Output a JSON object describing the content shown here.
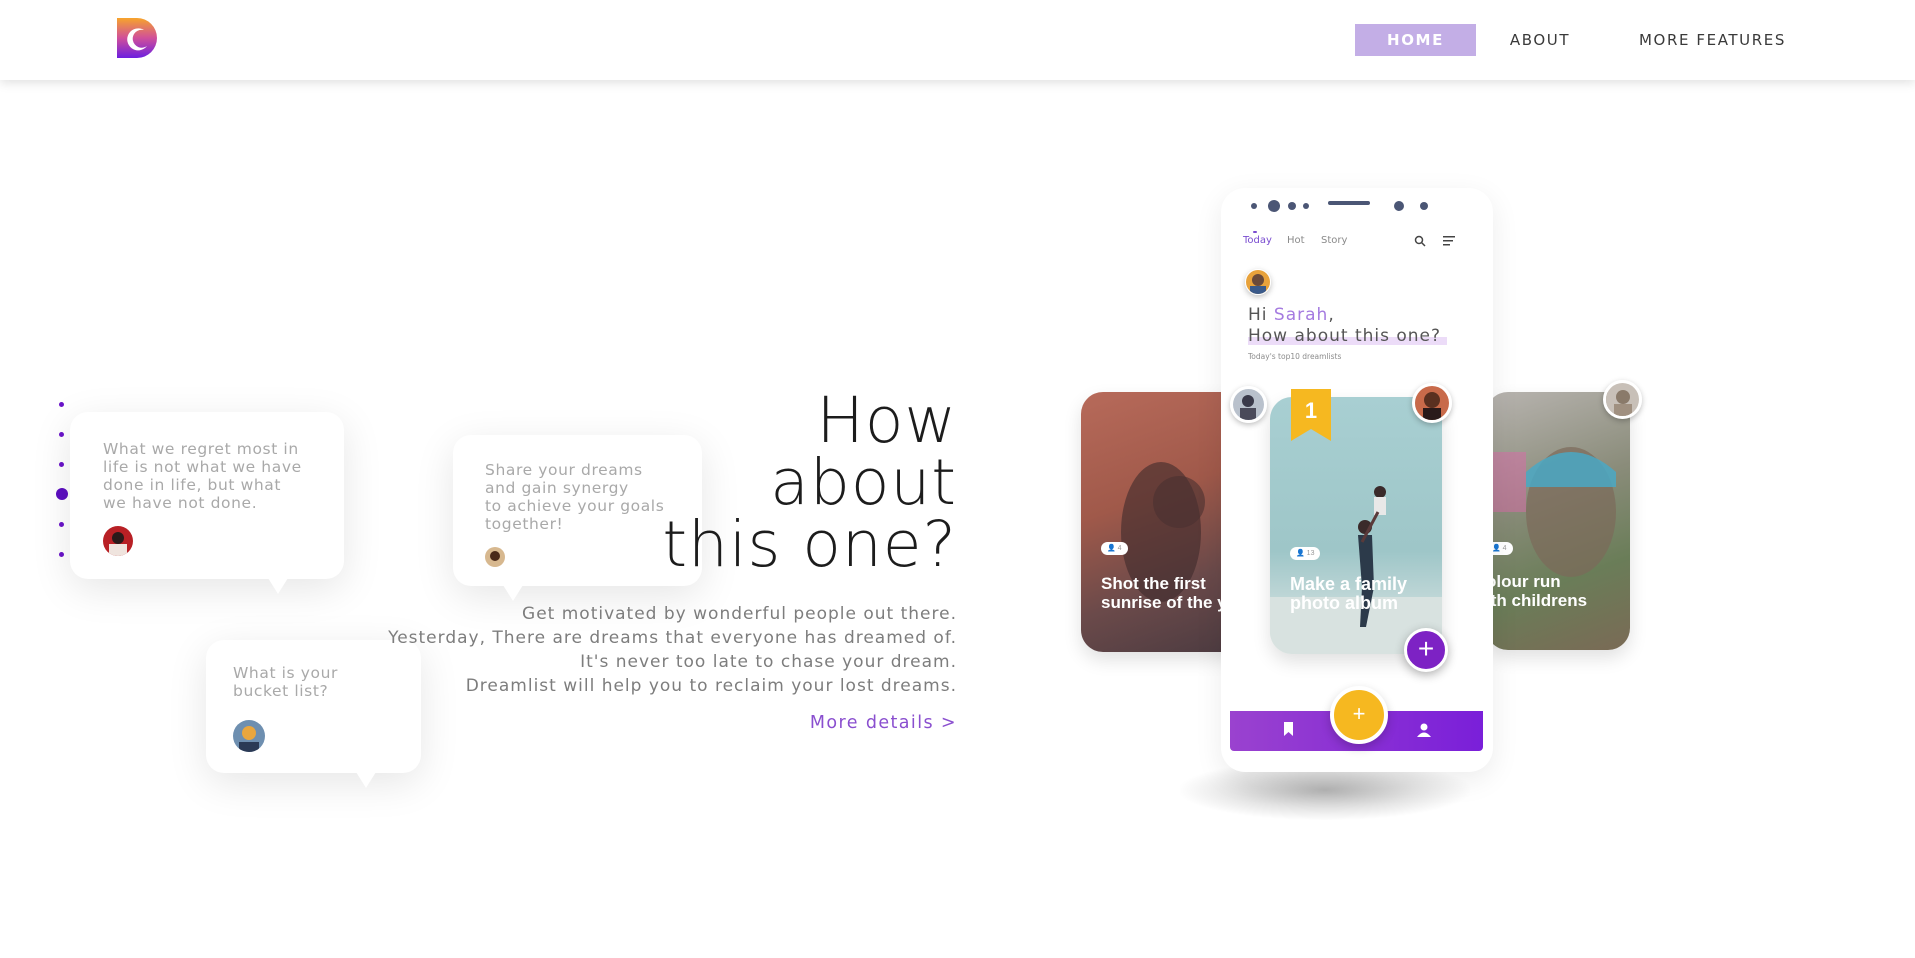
{
  "nav": {
    "items": [
      {
        "label": "HOME",
        "active": true
      },
      {
        "label": "ABOUT",
        "active": false
      },
      {
        "label": "MORE FEATURES",
        "active": false
      }
    ]
  },
  "pagination": {
    "total": 6,
    "active_index": 3
  },
  "bubbles": [
    {
      "text": "What we regret most in\nlife is not what we have\ndone in life, but what\nwe have not done."
    },
    {
      "text": "Share your dreams\nand gain synergy\nto achieve your goals\ntogether!"
    },
    {
      "text": "What is your\nbucket list?"
    }
  ],
  "hero": {
    "title_lines": [
      "How",
      "about",
      "this one?"
    ],
    "description_lines": [
      "Get motivated by wonderful people out there.",
      "Yesterday, There are dreams that everyone has dreamed of.",
      "It's never too late to chase your dream.",
      "Dreamlist will help you to reclaim your lost dreams."
    ],
    "more_link": "More details >"
  },
  "phone": {
    "tabs": [
      {
        "label": "Today",
        "active": true
      },
      {
        "label": "Hot",
        "active": false
      },
      {
        "label": "Story",
        "active": false
      }
    ],
    "greeting_prefix": "Hi ",
    "greeting_name": "Sarah",
    "greeting_suffix": ",",
    "greeting_line2": "How about this one?",
    "subtitle": "Today's top10 dreamlists",
    "rank": "1",
    "fab_label": "+",
    "plus_label": "+"
  },
  "cards": [
    {
      "title_line1": "Shot the first",
      "title_line2": "sunrise of the ye",
      "count": "4"
    },
    {
      "title_line1": "Make a family",
      "title_line2": "photo album",
      "count": "13"
    },
    {
      "title_line1": "olour run",
      "title_line2": "ith childrens",
      "count": "4"
    }
  ],
  "colors": {
    "brand_purple": "#7a1fd9",
    "nav_active_bg": "#c3aee6",
    "accent_yellow": "#f6b820",
    "link_purple": "#8a4fcf"
  }
}
